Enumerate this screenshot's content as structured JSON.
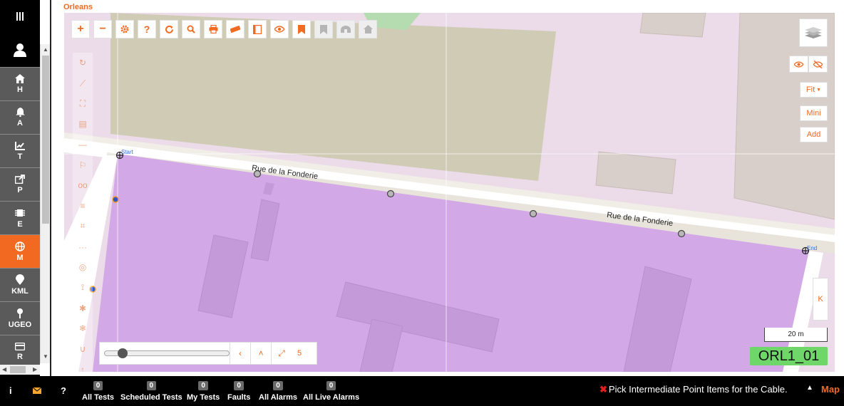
{
  "app": {
    "title": "Orleans"
  },
  "leftnav": {
    "items": [
      {
        "icon": "home-icon",
        "label": "H"
      },
      {
        "icon": "bell-icon",
        "label": "A"
      },
      {
        "icon": "chart-icon",
        "label": "T"
      },
      {
        "icon": "share-icon",
        "label": "P"
      },
      {
        "icon": "chip-icon",
        "label": "E"
      },
      {
        "icon": "globe-icon",
        "label": "M",
        "active": true
      },
      {
        "icon": "pin-icon",
        "label": "KML"
      },
      {
        "icon": "map-pin-icon",
        "label": "UGEO"
      },
      {
        "icon": "card-icon",
        "label": "R"
      }
    ]
  },
  "map": {
    "street_label_1": "Rue de la Fonderie",
    "street_label_2": "Rue de la Fonderie",
    "start_label": "Start",
    "end_label": "End",
    "scale": "20 m",
    "cable_label": "ORL1_01",
    "fit_button": "Fit",
    "mini_button": "Mini",
    "add_button": "Add",
    "k_button": "K",
    "slider_count": "5"
  },
  "toolbar": {
    "buttons": [
      "plus-icon",
      "minus-icon",
      "gear-icon",
      "help-icon",
      "refresh-icon",
      "search-icon",
      "print-icon",
      "ruler-icon",
      "book-icon",
      "eye-icon",
      "bookmark-icon",
      "bookmark-disabled-icon",
      "tunnel-icon",
      "house-icon"
    ]
  },
  "bottombar": {
    "items": [
      {
        "count": "0",
        "label": "All Tests"
      },
      {
        "count": "0",
        "label": "Scheduled Tests"
      },
      {
        "count": "0",
        "label": "My Tests"
      },
      {
        "count": "0",
        "label": "Faults"
      },
      {
        "count": "0",
        "label": "All Alarms"
      },
      {
        "count": "0",
        "label": "All Live Alarms"
      }
    ],
    "status_message": "Pick Intermediate Point Items for the Cable.",
    "map_link": "Map"
  },
  "colors": {
    "accent": "#f26a21",
    "active_nav": "#f26a21",
    "cable_label_bg": "#6fd66a",
    "area_purple": "#d2a8e6"
  }
}
